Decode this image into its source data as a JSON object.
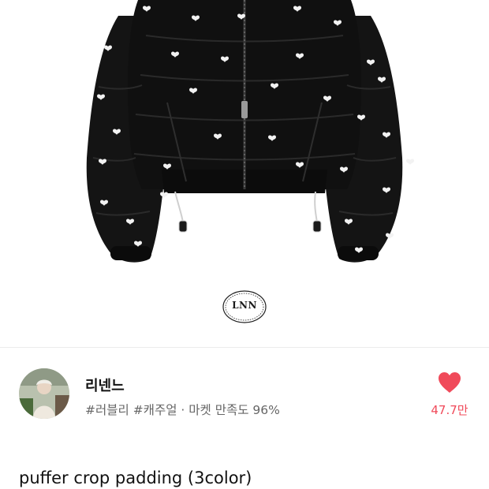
{
  "product": {
    "logo_text": "LNN",
    "title": "puffer crop padding (3color)"
  },
  "seller": {
    "name": "리넨느",
    "tags": "#러블리 #캐주얼 · 마켓 만족도 96%"
  },
  "likes": {
    "count": "47.7만",
    "icon": "heart-icon"
  },
  "colors": {
    "accent": "#f04a5a",
    "jacket": "#121212",
    "muted_text": "#666666"
  }
}
